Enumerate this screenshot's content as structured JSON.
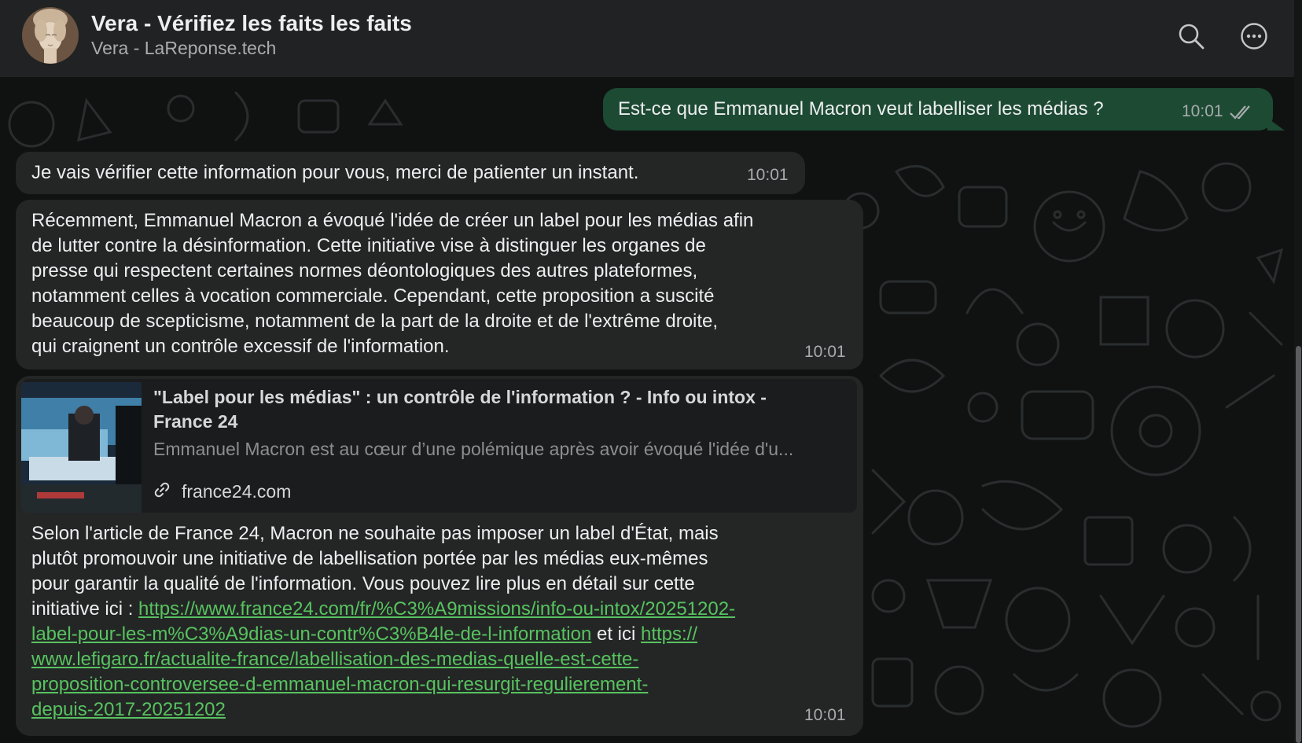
{
  "header": {
    "title": "Vera - Vérifiez les faits les faits",
    "subtitle": "Vera - LaReponse.tech",
    "icons": [
      "search-icon",
      "more-options-icon"
    ]
  },
  "messages": {
    "outgoing_1": {
      "text": "Est-ce que Emmanuel Macron veut labelliser les médias ?",
      "time": "10:01",
      "status_icon": "double-check-icon"
    },
    "incoming_1": {
      "text": "Je vais vérifier cette information pour vous, merci de patienter un instant.",
      "time": "10:01"
    },
    "incoming_2": {
      "lines": [
        "Récemment, Emmanuel Macron a évoqué l'idée de créer un label pour les médias afin",
        "de lutter contre la désinformation. Cette initiative vise à distinguer les organes de",
        "presse qui respectent certaines normes déontologiques des autres plateformes,",
        "notamment celles à vocation commerciale. Cependant, cette proposition a suscité",
        "beaucoup de scepticisme, notamment de la part de la droite et de l'extrême droite,",
        "qui craignent un contrôle excessif de l'information."
      ],
      "time": "10:01"
    },
    "incoming_3": {
      "preview": {
        "title_line1": "\"Label pour les médias\" : un contrôle de l'information ? - Info ou intox -",
        "title_line2": "France 24",
        "description": "Emmanuel Macron est au cœur d’une polémique après avoir évoqué l'idée d'u...",
        "domain": "france24.com"
      },
      "body_lines": [
        "Selon l'article de France 24, Macron ne souhaite pas imposer un label d'État, mais",
        "plutôt promouvoir une initiative de labellisation portée par les médias eux-mêmes",
        "pour garantir la qualité de l'information. Vous pouvez lire plus en détail sur cette"
      ],
      "line4_prefix": "initiative ici : ",
      "link1_part1": "https://www.france24.com/fr/%C3%A9missions/info-ou-intox/20251202-",
      "link1_part2": "label-pour-les-m%C3%A9dias-un-contr%C3%B4le-de-l-information",
      "connector": " et ici ",
      "link2_part1": "https://",
      "link2_part2": "www.lefigaro.fr/actualite-france/labellisation-des-medias-quelle-est-cette-",
      "link2_part3": "proposition-controversee-d-emmanuel-macron-qui-resurgit-regulierement-",
      "link2_part4": "depuis-2017-20251202",
      "time": "10:01"
    }
  },
  "colors": {
    "outgoing_bubble": "#1d4a33",
    "incoming_bubble": "#242626",
    "link": "#57c35f",
    "header_bg": "#202223"
  }
}
